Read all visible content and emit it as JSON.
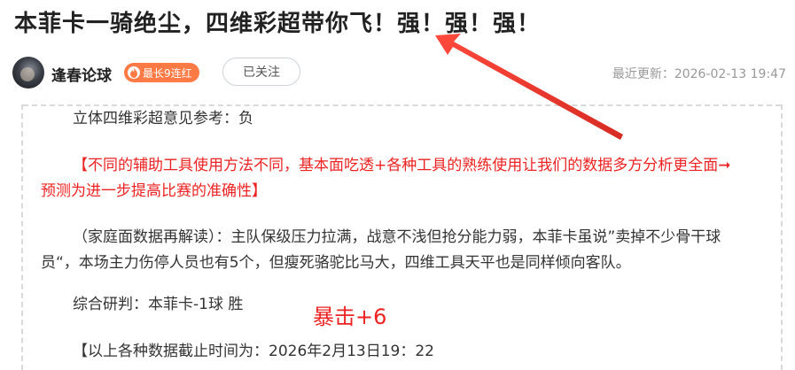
{
  "article": {
    "title": "本菲卡一骑绝尘，四维彩超带你飞！强！强！强！",
    "author": "逢春论球",
    "streak_badge": "最长9连红",
    "follow_label": "已关注",
    "updated_label": "最近更新：",
    "updated_time": "2026-02-13 19:47",
    "paragraphs": {
      "p1": "立体四维彩超意见参考：负",
      "p2_line1": "【不同的辅助工具使用方法不同，基本面吃透+各种工具的熟练使用让我们的数据多方分析更全面➞",
      "p2_line2": "预测为进一步提高比赛的准确性】",
      "p3_line1": "（家庭面数据再解读）：主队保级压力拉满，战意不浅但抢分能力弱，本菲卡虽说”卖掉不少骨干球",
      "p3_line2": "员“，本场主力伤停人员也有5个，但瘦死骆驼比马大，四维工具天平也是同样倾向客队。",
      "p4": "综合研判：本菲卡-1球 胜",
      "p5": "【以上各种数据截止时间为：2026年2月13日19：22"
    },
    "annotation": "暴击+6"
  },
  "colors": {
    "accent_red": "#ee2222",
    "streak_orange": "#ff7a45",
    "arrow_red": "#e8392f"
  },
  "icons": {
    "avatar": "avatar",
    "streak": "flame-icon",
    "annotation_arrow": "arrow-icon"
  }
}
